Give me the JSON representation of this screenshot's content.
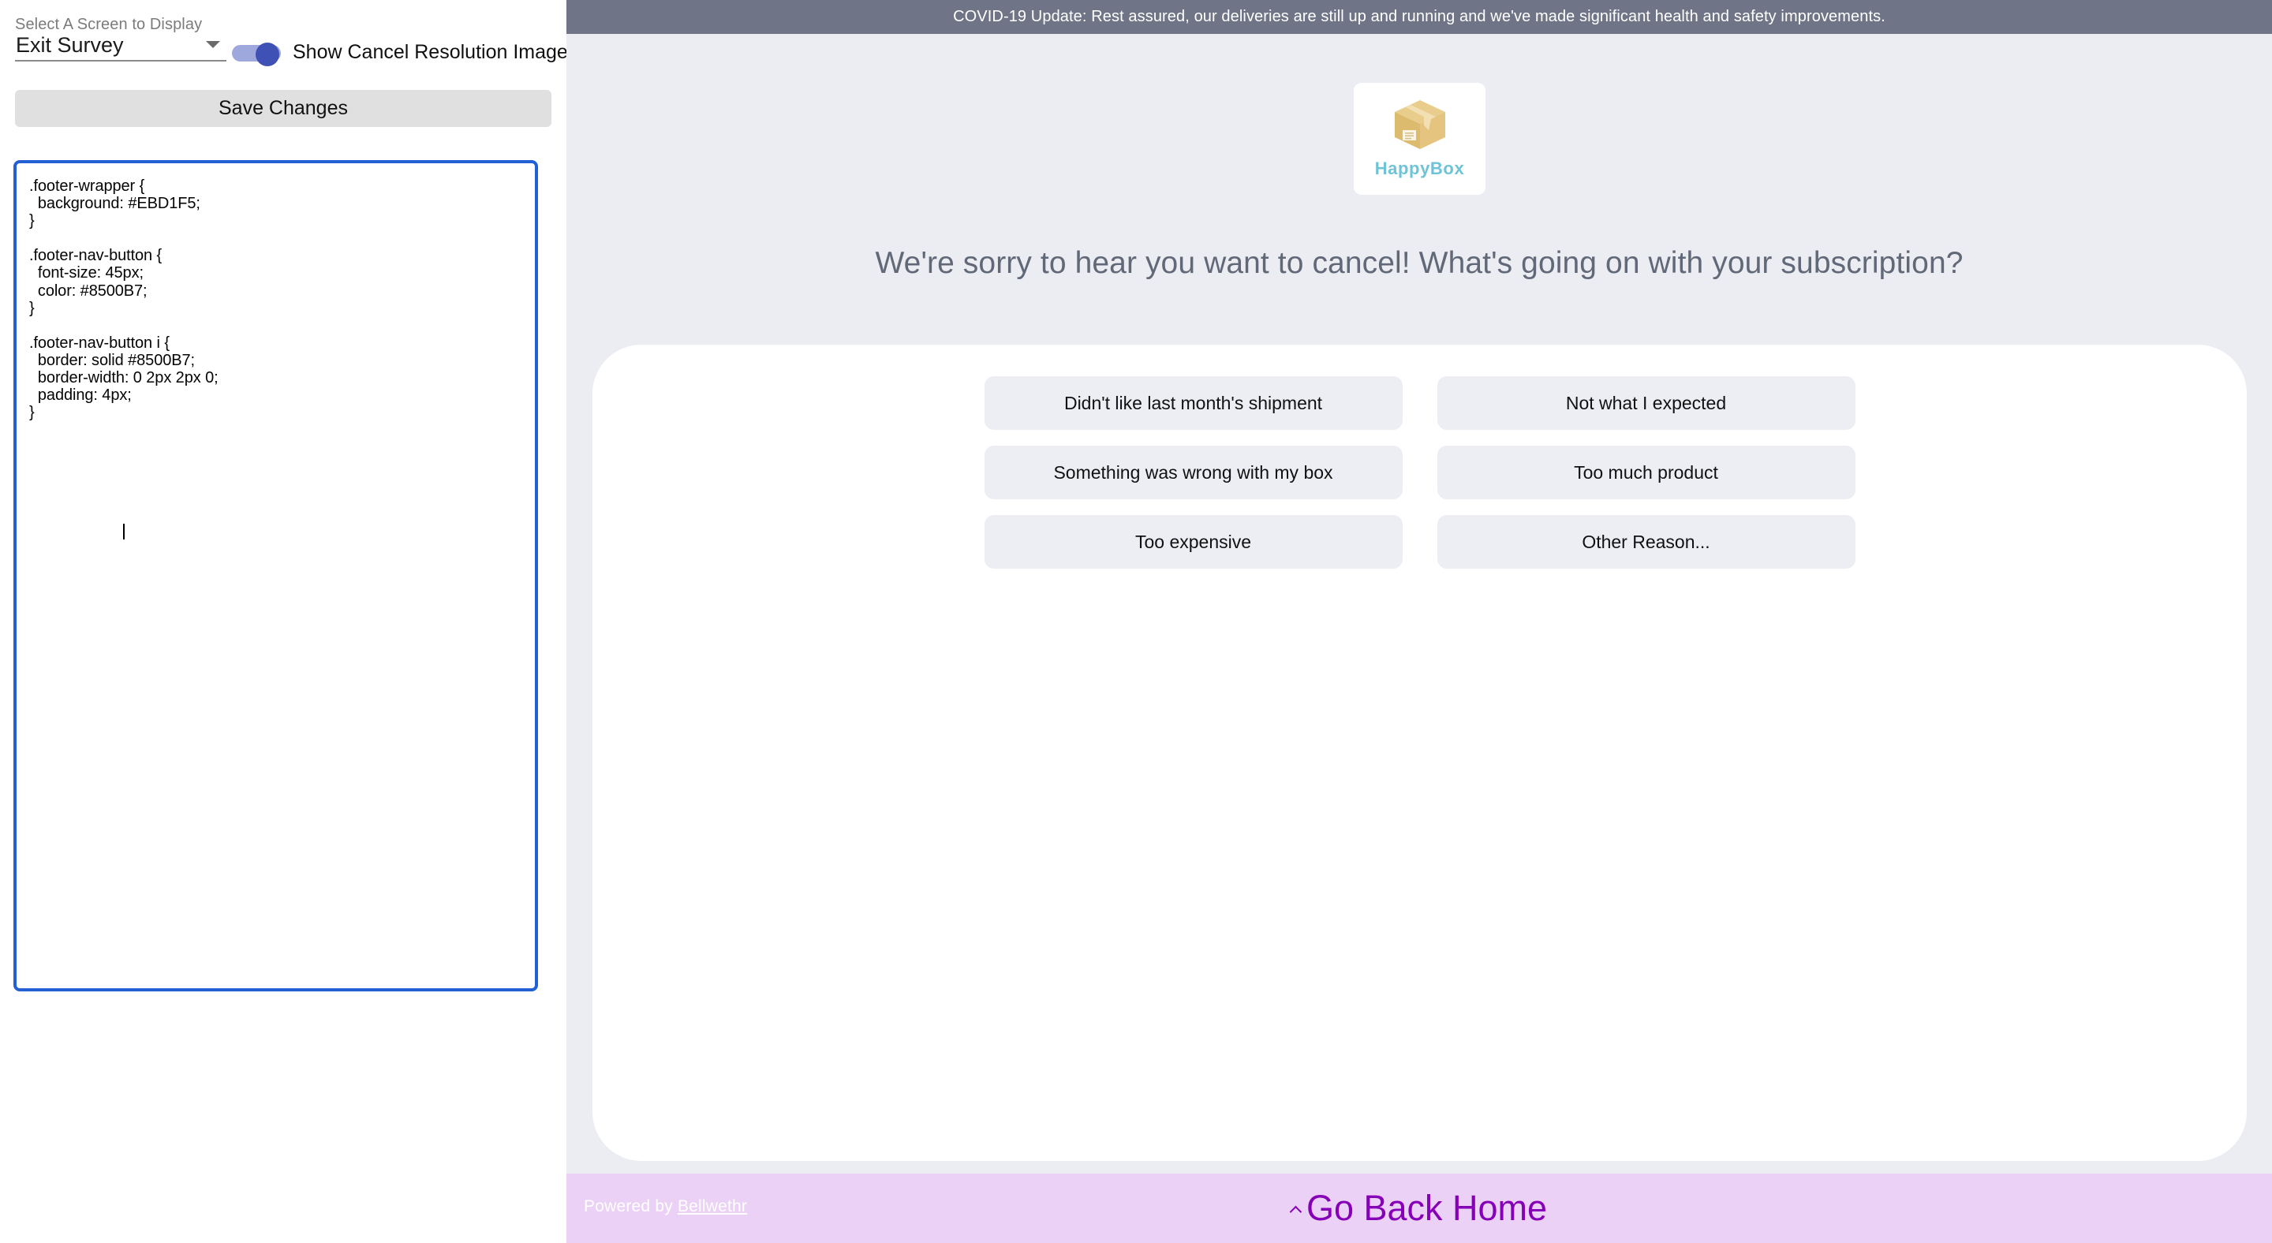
{
  "editor": {
    "select_label": "Select A Screen to Display",
    "select_value": "Exit Survey",
    "select_options": [
      "Exit Survey"
    ],
    "caret_icon": "chevron-down-icon",
    "toggle_label": "Show Cancel Resolution Image",
    "toggle_state": "on",
    "toggle_on_color": "#3f51b5",
    "toggle_track_color": "#9fa8dd",
    "save_label": "Save Changes",
    "focus_border_color": "#2260d4",
    "code": ".footer-wrapper {\n  background: #EBD1F5;\n}\n\n.footer-nav-button {\n  font-size: 45px;\n  color: #8500B7;\n}\n\n.footer-nav-button i {\n  border: solid #8500B7;\n  border-width: 0 2px 2px 0;\n  padding: 4px;\n}"
  },
  "preview": {
    "banner": {
      "text": "COVID-19 Update: Rest assured, our deliveries are still up and running and we've made significant health and safety improvements.",
      "background": "#6F7486",
      "text_color": "#FFFFFF"
    },
    "brand": {
      "name": "HappyBox",
      "logo_icon": "cardboard-box-icon",
      "name_color": "#6EC4D6",
      "box_color": "#E5C57D"
    },
    "headline": "We're sorry to hear you want to cancel! What's going on with your subscription?",
    "headline_color": "#616877",
    "options": [
      "Didn't like last month's shipment",
      "Not what I expected",
      "Something was wrong with my box",
      "Too much product",
      "Too expensive",
      "Other Reason..."
    ],
    "option_background": "#EDEEF4",
    "page_background": "#ECEDF2",
    "card_background": "#FFFFFF",
    "footer": {
      "powered_by_prefix": "Powered by ",
      "powered_by_link": "Bellwethr",
      "nav_button_label": "Go Back Home",
      "nav_chevron_icon": "chevron-up-icon",
      "background": "#EBD1F5",
      "nav_color": "#8500B7"
    }
  }
}
